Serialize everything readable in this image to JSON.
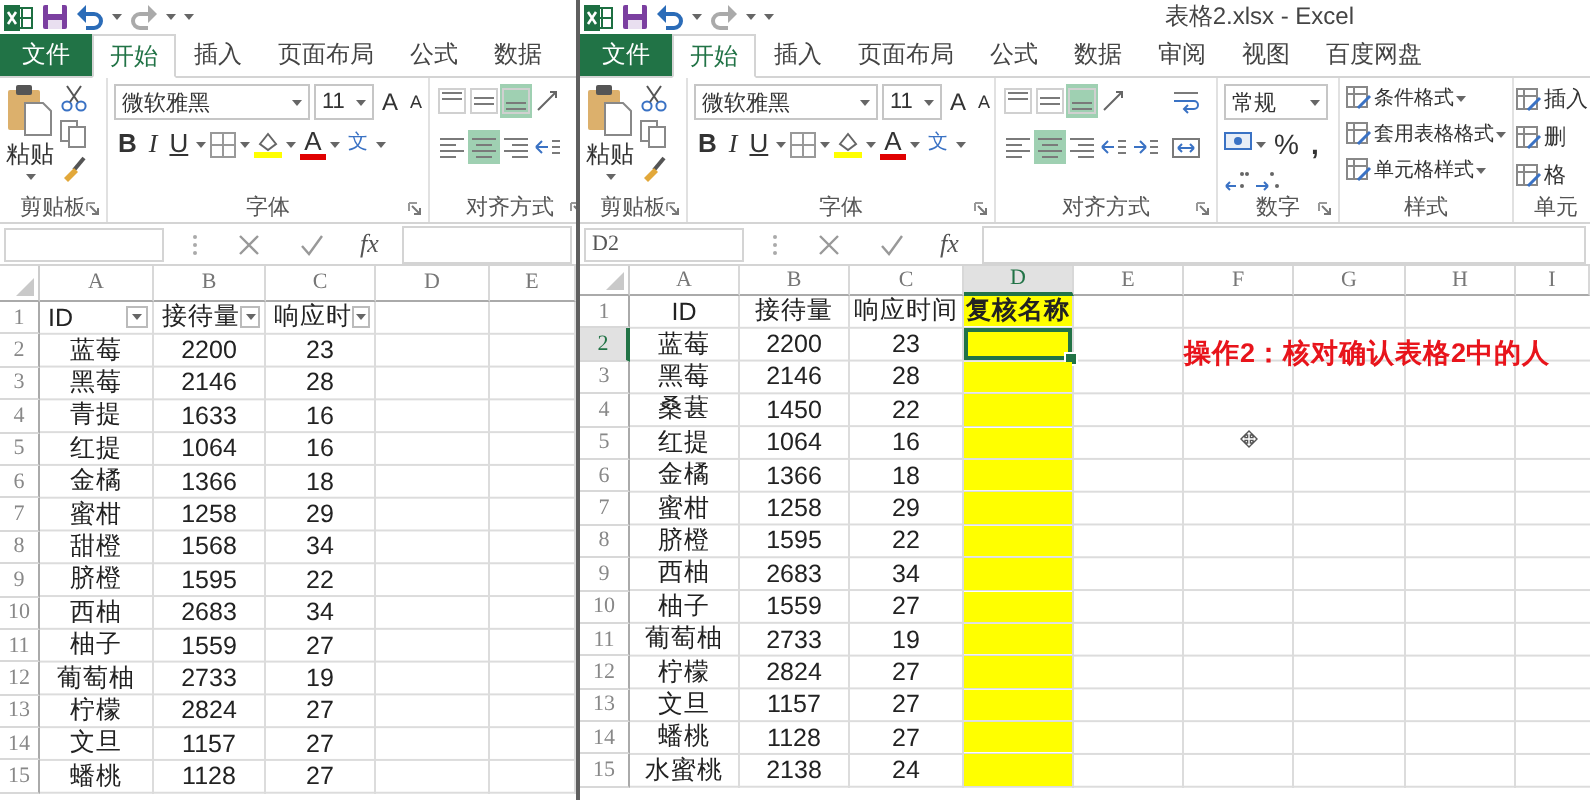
{
  "windows": [
    {
      "kind": "left",
      "tabs": [
        {
          "label": "文件",
          "kind": "file",
          "selected": false
        },
        {
          "label": "开始",
          "kind": "tab",
          "selected": true
        },
        {
          "label": "插入",
          "kind": "tab",
          "selected": false
        },
        {
          "label": "页面布局",
          "kind": "tab",
          "selected": false
        },
        {
          "label": "公式",
          "kind": "tab",
          "selected": false
        },
        {
          "label": "数据",
          "kind": "tab",
          "selected": false
        }
      ],
      "ribbon": [
        {
          "kind": "clipboard",
          "label": "剪贴板",
          "paste": "粘贴"
        },
        {
          "kind": "font",
          "label": "字体",
          "font_name": "微软雅黑",
          "font_size": "11",
          "grow": "A",
          "shrink": "A",
          "bold": "B",
          "italic": "I",
          "underline": "U",
          "font_color": "A",
          "phonetic": "文"
        },
        {
          "kind": "alignment",
          "label": "对齐方式",
          "buttons": [
            {
              "kind": "top",
              "selected": false
            },
            {
              "kind": "middle",
              "selected": false
            },
            {
              "kind": "bottom",
              "selected": true
            },
            {
              "kind": "orientation",
              "selected": false
            },
            {
              "kind": "left",
              "selected": false
            },
            {
              "kind": "center",
              "selected": true
            },
            {
              "kind": "right",
              "selected": false
            },
            {
              "kind": "indent_decrease",
              "selected": false
            }
          ]
        }
      ],
      "formula_bar": {
        "fx": "fx"
      },
      "sheet": {
        "columns": [
          {
            "label": "A",
            "selected": false,
            "highlighted": false
          },
          {
            "label": "B",
            "selected": false,
            "highlighted": false
          },
          {
            "label": "C",
            "selected": false,
            "highlighted": false
          },
          {
            "label": "D",
            "selected": false,
            "highlighted": false
          },
          {
            "label": "E",
            "selected": false,
            "highlighted": false
          }
        ],
        "rows": [
          {
            "number": "1",
            "selected": false,
            "filter": true,
            "cells": [
              "ID",
              "接待量",
              "响应时"
            ]
          },
          {
            "number": "2",
            "selected": false,
            "cells": [
              "蓝莓",
              "2200",
              "23"
            ]
          },
          {
            "number": "3",
            "selected": false,
            "cells": [
              "黑莓",
              "2146",
              "28"
            ]
          },
          {
            "number": "4",
            "selected": false,
            "cells": [
              "青提",
              "1633",
              "16"
            ]
          },
          {
            "number": "5",
            "selected": false,
            "cells": [
              "红提",
              "1064",
              "16"
            ]
          },
          {
            "number": "6",
            "selected": false,
            "cells": [
              "金橘",
              "1366",
              "18"
            ]
          },
          {
            "number": "7",
            "selected": false,
            "cells": [
              "蜜柑",
              "1258",
              "29"
            ]
          },
          {
            "number": "8",
            "selected": false,
            "cells": [
              "甜橙",
              "1568",
              "34"
            ]
          },
          {
            "number": "9",
            "selected": false,
            "cells": [
              "脐橙",
              "1595",
              "22"
            ]
          },
          {
            "number": "10",
            "selected": false,
            "cells": [
              "西柚",
              "2683",
              "34"
            ]
          },
          {
            "number": "11",
            "selected": false,
            "cells": [
              "柚子",
              "1559",
              "27"
            ]
          },
          {
            "number": "12",
            "selected": false,
            "cells": [
              "葡萄柚",
              "2733",
              "19"
            ]
          },
          {
            "number": "13",
            "selected": false,
            "cells": [
              "柠檬",
              "2824",
              "27"
            ]
          },
          {
            "number": "14",
            "selected": false,
            "cells": [
              "文旦",
              "1157",
              "27"
            ]
          },
          {
            "number": "15",
            "selected": false,
            "cells": [
              "蟠桃",
              "1128",
              "27"
            ]
          }
        ]
      }
    },
    {
      "kind": "right",
      "title": "表格2.xlsx - Excel",
      "tabs": [
        {
          "label": "文件",
          "kind": "file",
          "selected": false
        },
        {
          "label": "开始",
          "kind": "tab",
          "selected": true
        },
        {
          "label": "插入",
          "kind": "tab",
          "selected": false
        },
        {
          "label": "页面布局",
          "kind": "tab",
          "selected": false
        },
        {
          "label": "公式",
          "kind": "tab",
          "selected": false
        },
        {
          "label": "数据",
          "kind": "tab",
          "selected": false
        },
        {
          "label": "审阅",
          "kind": "tab",
          "selected": false
        },
        {
          "label": "视图",
          "kind": "tab",
          "selected": false
        },
        {
          "label": "百度网盘",
          "kind": "tab",
          "selected": false
        }
      ],
      "ribbon": [
        {
          "kind": "clipboard",
          "label": "剪贴板",
          "paste": "粘贴"
        },
        {
          "kind": "font",
          "label": "字体",
          "font_name": "微软雅黑",
          "font_size": "11",
          "grow": "A",
          "shrink": "A",
          "bold": "B",
          "italic": "I",
          "underline": "U",
          "font_color": "A",
          "phonetic": "文"
        },
        {
          "kind": "alignment",
          "label": "对齐方式",
          "buttons": [
            {
              "kind": "top",
              "selected": false
            },
            {
              "kind": "middle",
              "selected": false
            },
            {
              "kind": "bottom",
              "selected": true
            },
            {
              "kind": "orientation",
              "selected": false
            },
            {
              "kind": "left",
              "selected": false
            },
            {
              "kind": "center",
              "selected": true
            },
            {
              "kind": "right",
              "selected": false
            },
            {
              "kind": "indent_decrease",
              "selected": false
            },
            {
              "kind": "indent_increase",
              "selected": false
            },
            {
              "kind": "wrap",
              "selected": false
            },
            {
              "kind": "merge",
              "selected": false
            }
          ]
        },
        {
          "kind": "number",
          "label": "数字",
          "format": "常规",
          "percent": "%",
          "comma": ","
        },
        {
          "kind": "styles",
          "label": "样式",
          "items": [
            "条件格式",
            "套用表格格式",
            "单元格样式"
          ]
        },
        {
          "kind": "cells",
          "label": "单元",
          "items": [
            "插入",
            "删",
            "格"
          ]
        }
      ],
      "formula_bar": {
        "name_box": "D2",
        "fx": "fx"
      },
      "sheet": {
        "columns": [
          {
            "label": "A",
            "selected": false,
            "highlighted": false
          },
          {
            "label": "B",
            "selected": false,
            "highlighted": false
          },
          {
            "label": "C",
            "selected": false,
            "highlighted": false
          },
          {
            "label": "D",
            "selected": true,
            "highlighted": true
          },
          {
            "label": "E",
            "selected": false,
            "highlighted": false
          },
          {
            "label": "F",
            "selected": false,
            "highlighted": false
          },
          {
            "label": "G",
            "selected": false,
            "highlighted": false
          },
          {
            "label": "H",
            "selected": false,
            "highlighted": false
          },
          {
            "label": "I",
            "selected": false,
            "highlighted": false
          }
        ],
        "rows": [
          {
            "number": "1",
            "selected": false,
            "cells": [
              "ID",
              "接待量",
              "响应时间",
              "复核名称"
            ]
          },
          {
            "number": "2",
            "selected": true,
            "cells": [
              "蓝莓",
              "2200",
              "23"
            ]
          },
          {
            "number": "3",
            "selected": false,
            "cells": [
              "黑莓",
              "2146",
              "28"
            ]
          },
          {
            "number": "4",
            "selected": false,
            "cells": [
              "桑葚",
              "1450",
              "22"
            ]
          },
          {
            "number": "5",
            "selected": false,
            "cells": [
              "红提",
              "1064",
              "16"
            ]
          },
          {
            "number": "6",
            "selected": false,
            "cells": [
              "金橘",
              "1366",
              "18"
            ]
          },
          {
            "number": "7",
            "selected": false,
            "cells": [
              "蜜柑",
              "1258",
              "29"
            ]
          },
          {
            "number": "8",
            "selected": false,
            "cells": [
              "脐橙",
              "1595",
              "22"
            ]
          },
          {
            "number": "9",
            "selected": false,
            "cells": [
              "西柚",
              "2683",
              "34"
            ]
          },
          {
            "number": "10",
            "selected": false,
            "cells": [
              "柚子",
              "1559",
              "27"
            ]
          },
          {
            "number": "11",
            "selected": false,
            "cells": [
              "葡萄柚",
              "2733",
              "19"
            ]
          },
          {
            "number": "12",
            "selected": false,
            "cells": [
              "柠檬",
              "2824",
              "27"
            ]
          },
          {
            "number": "13",
            "selected": false,
            "cells": [
              "文旦",
              "1157",
              "27"
            ]
          },
          {
            "number": "14",
            "selected": false,
            "cells": [
              "蟠桃",
              "1128",
              "27"
            ]
          },
          {
            "number": "15",
            "selected": false,
            "cells": [
              "水蜜桃",
              "2138",
              "24"
            ]
          }
        ],
        "annotation": {
          "text": "操作2：核对确认表格2中的人"
        }
      }
    }
  ]
}
